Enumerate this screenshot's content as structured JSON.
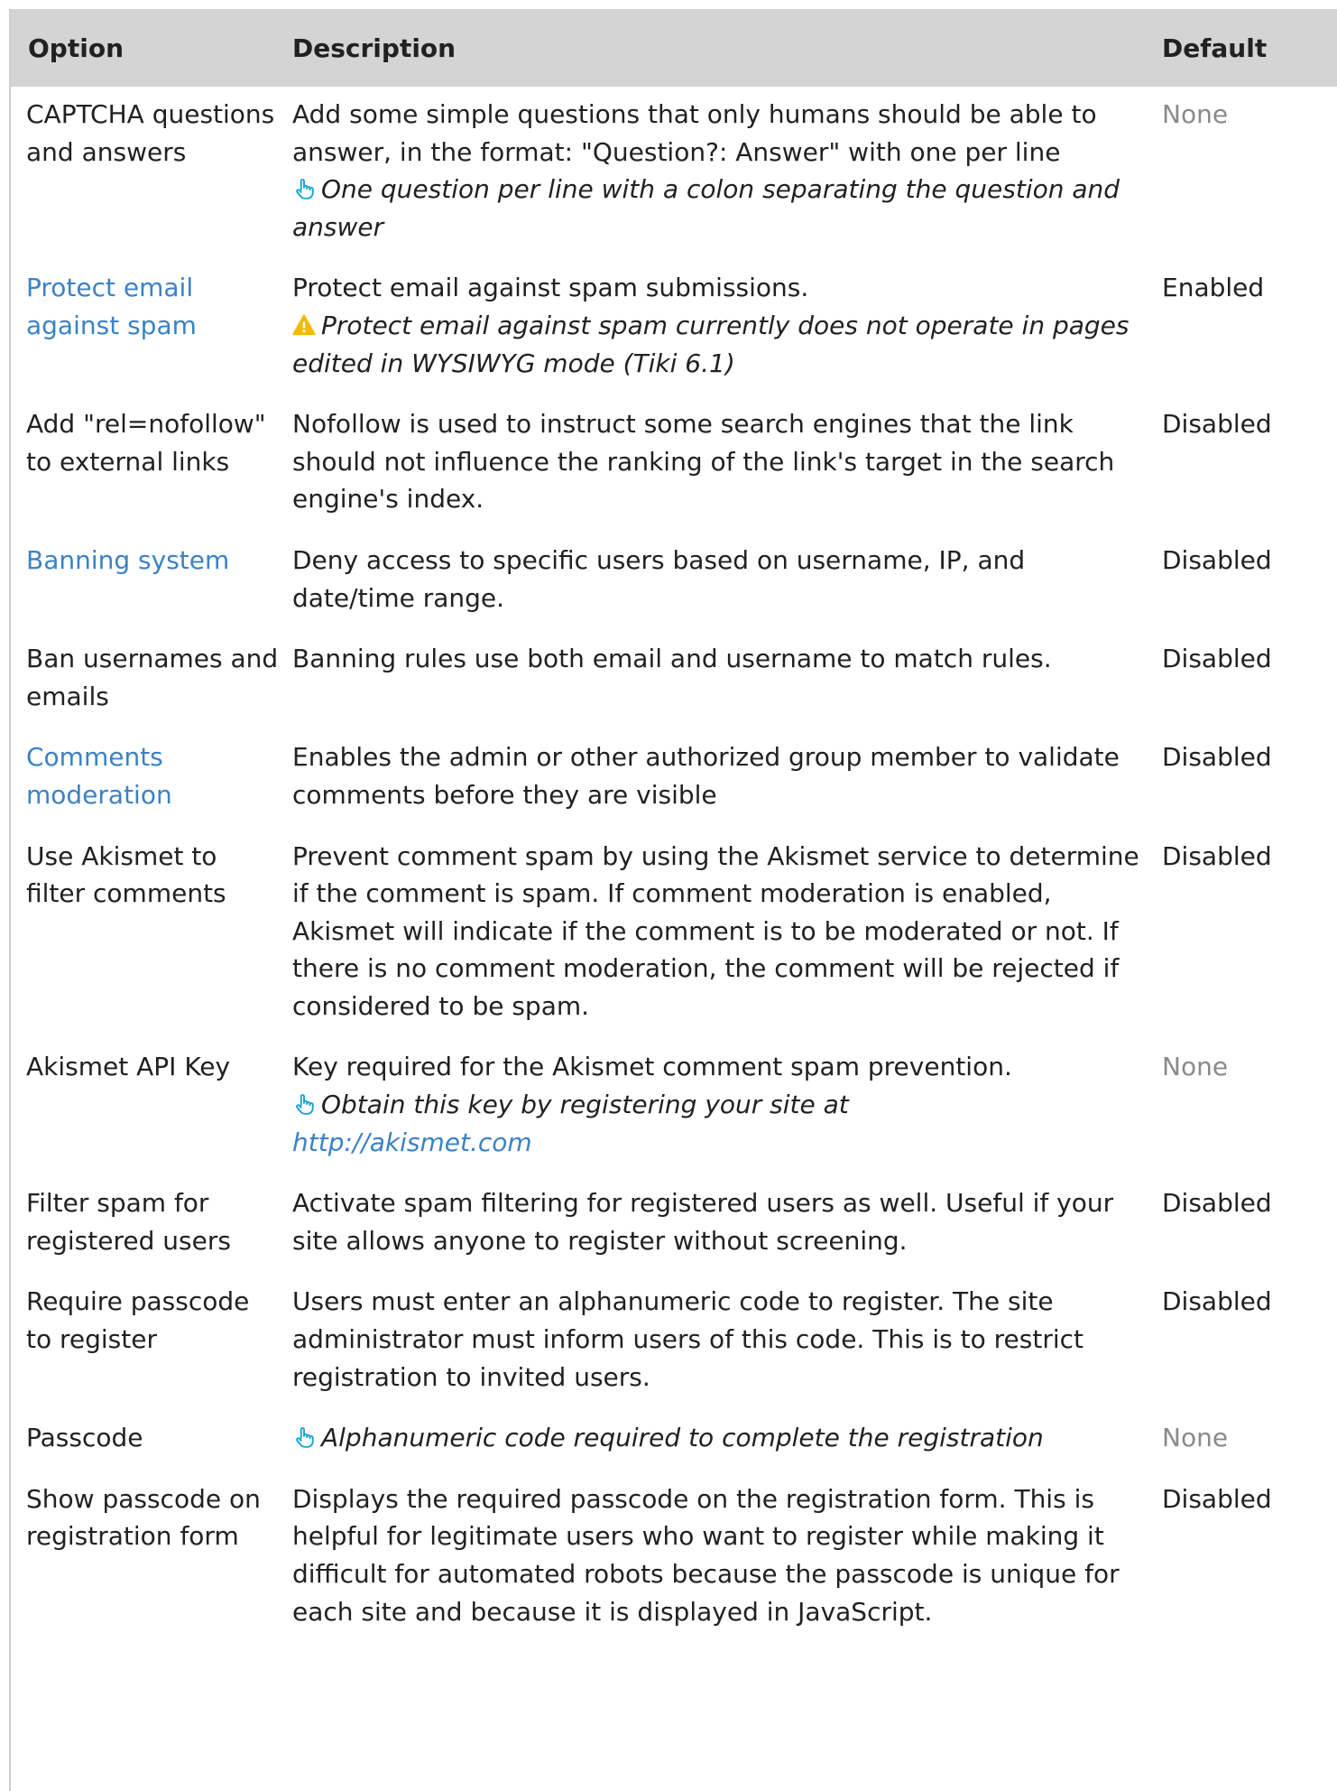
{
  "table": {
    "headers": {
      "option": "Option",
      "description": "Description",
      "default": "Default"
    },
    "rows": [
      {
        "option": "CAPTCHA questions and answers",
        "option_link": false,
        "description": "Add some simple questions that only humans should be able to answer, in the format: \"Question?: Answer\" with one per line",
        "note": "One question per line with a colon separating the question and answer",
        "note_icon": "hand-pointer-icon",
        "default": "None",
        "default_muted": true
      },
      {
        "option": "Protect email against spam",
        "option_link": true,
        "description": "Protect email against spam submissions.",
        "note": "Protect email against spam currently does not operate in pages edited in WYSIWYG mode (Tiki 6.1)",
        "note_icon": "warning-icon",
        "default": "Enabled",
        "default_muted": false
      },
      {
        "option": "Add \"rel=nofollow\" to external links",
        "option_link": false,
        "description": "Nofollow is used to instruct some search engines that the link should not influence the ranking of the link's target in the search engine's index.",
        "default": "Disabled",
        "default_muted": false
      },
      {
        "option": "Banning system",
        "option_link": true,
        "description": "Deny access to specific users based on username, IP, and date/time range.",
        "default": "Disabled",
        "default_muted": false
      },
      {
        "option": "Ban usernames and emails",
        "option_link": false,
        "description": "Banning rules use both email and username to match rules.",
        "default": "Disabled",
        "default_muted": false
      },
      {
        "option": "Comments moderation",
        "option_link": true,
        "description": "Enables the admin or other authorized group member to validate comments before they are visible",
        "default": "Disabled",
        "default_muted": false
      },
      {
        "option": "Use Akismet to filter comments",
        "option_link": false,
        "description": "Prevent comment spam by using the Akismet service to determine if the comment is spam. If comment moderation is enabled, Akismet will indicate if the comment is to be moderated or not. If there is no comment moderation, the comment will be rejected if considered to be spam.",
        "default": "Disabled",
        "default_muted": false
      },
      {
        "option": "Akismet API Key",
        "option_link": false,
        "description": "Key required for the Akismet comment spam prevention.",
        "note": "Obtain this key by registering your site at",
        "note_icon": "hand-pointer-icon",
        "note_link": "http://akismet.com",
        "default": "None",
        "default_muted": true
      },
      {
        "option": "Filter spam for registered users",
        "option_link": false,
        "description": "Activate spam filtering for registered users as well. Useful if your site allows anyone to register without screening.",
        "default": "Disabled",
        "default_muted": false
      },
      {
        "option": "Require passcode to register",
        "option_link": false,
        "description": "Users must enter an alphanumeric code to register. The site administrator must inform users of this code. This is to restrict registration to invited users.",
        "default": "Disabled",
        "default_muted": false
      },
      {
        "option": "Passcode",
        "option_link": false,
        "note": "Alphanumeric code required to complete the registration",
        "note_icon": "hand-pointer-icon",
        "default": "None",
        "default_muted": true
      },
      {
        "option": "Show passcode on registration form",
        "option_link": false,
        "description": "Displays the required passcode on the registration form. This is helpful for legitimate users who want to register while making it difficult for automated robots because the passcode is unique for each site and because it is displayed in JavaScript.",
        "default": "Disabled",
        "default_muted": false
      }
    ]
  },
  "colors": {
    "link": "#3b82c4",
    "header_bg": "#d4d4d4",
    "muted": "#8a8a8a",
    "hand_icon": "#1aa3d9",
    "warning_icon": "#f5b800"
  }
}
